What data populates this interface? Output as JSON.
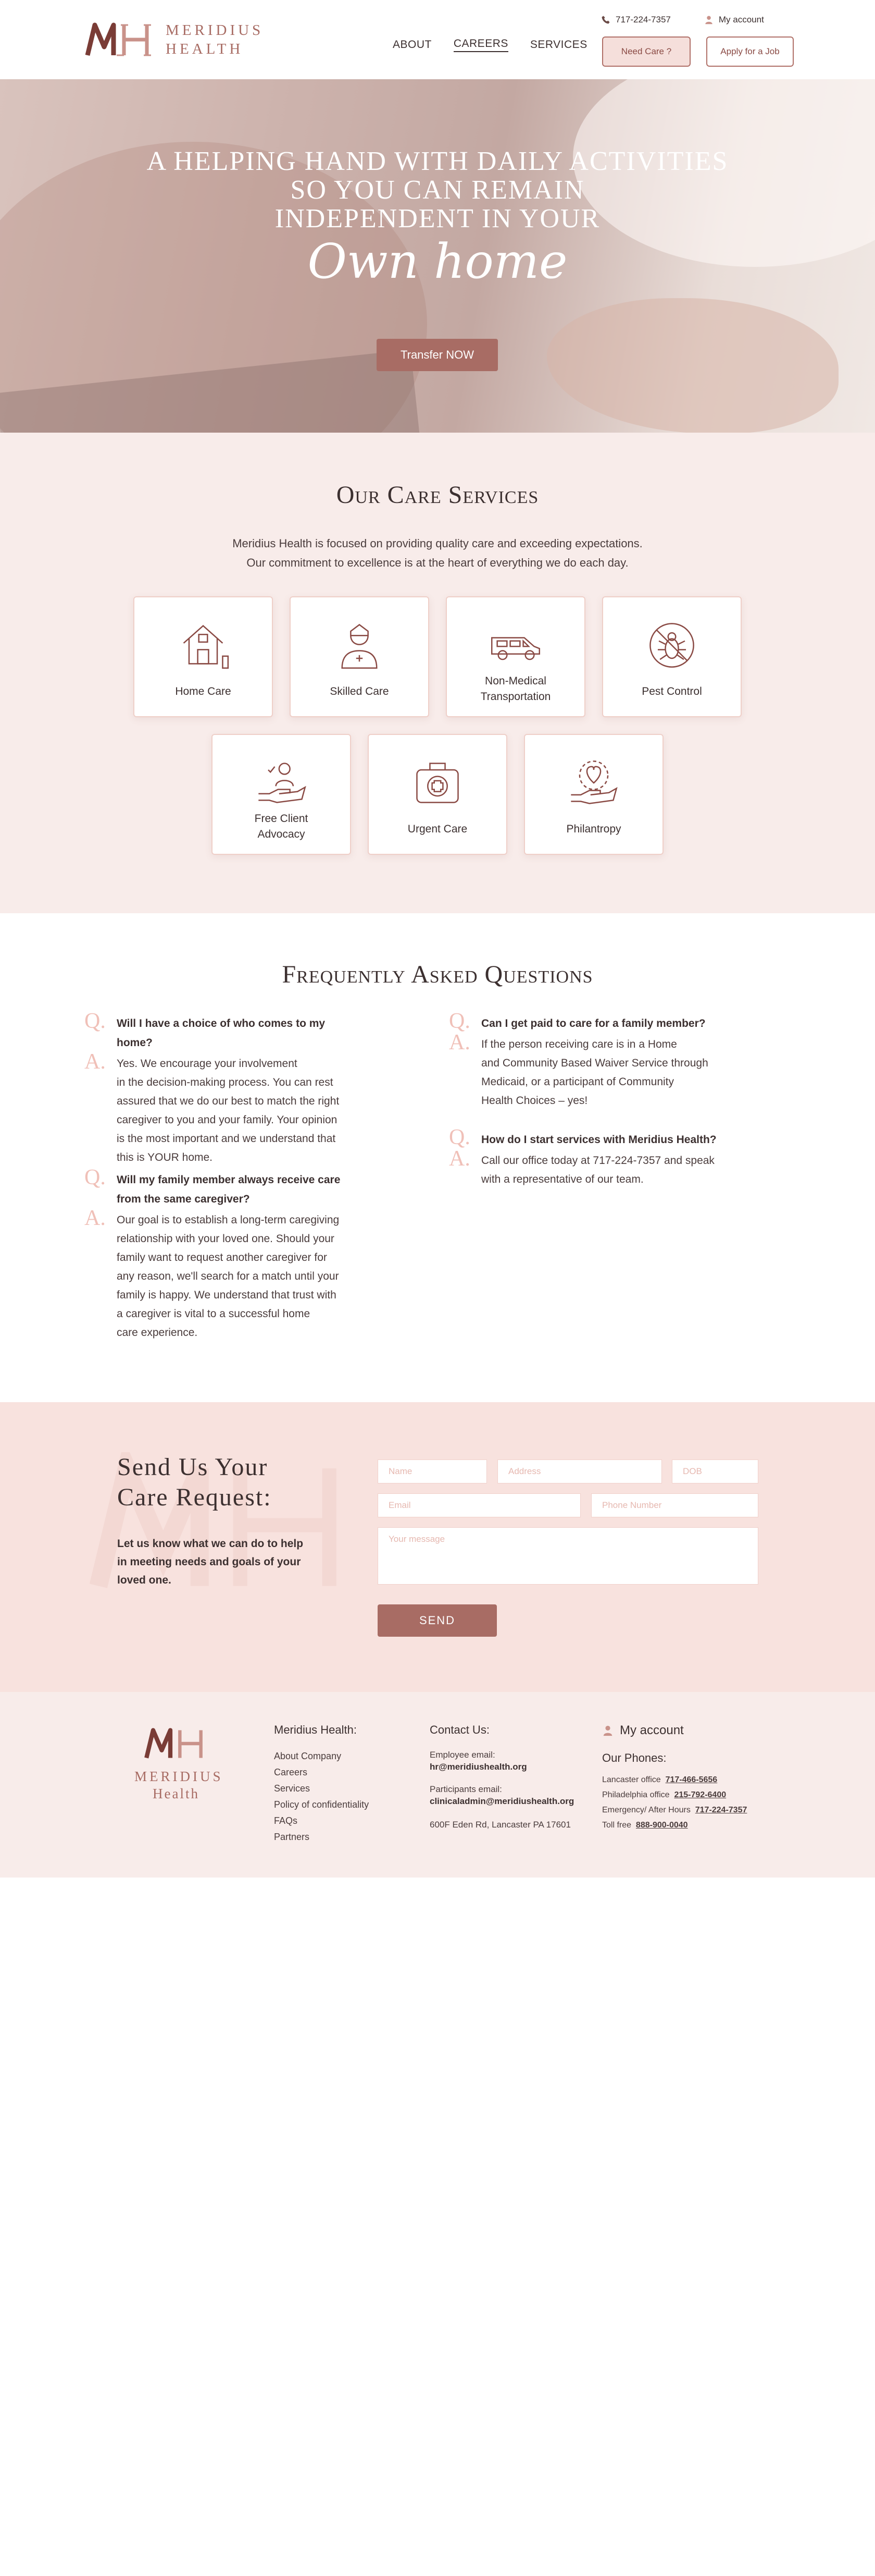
{
  "header": {
    "logo_line1": "MERIDIUS",
    "logo_line2": "HEALTH",
    "phone": "717-224-7357",
    "account": "My account",
    "nav": [
      {
        "label": "ABOUT"
      },
      {
        "label": "CAREERS"
      },
      {
        "label": "SERVICES"
      }
    ],
    "need_care": "Need Care ?",
    "apply": "Apply for a Job"
  },
  "hero": {
    "title_line1": "A helping hand with daily activities",
    "title_line2": "so you can remain",
    "title_line3": "independent in your",
    "script": "Own home",
    "button": "Transfer NOW"
  },
  "services": {
    "title": "Our Care Services",
    "subtitle_line1": "Meridius Health is focused on providing quality care and exceeding expectations.",
    "subtitle_line2": "Our commitment to excellence is at the heart of everything we do each day.",
    "cards": [
      {
        "label": "Home Care",
        "icon": "house-icon"
      },
      {
        "label": "Skilled Care",
        "icon": "nurse-icon"
      },
      {
        "label_line1": "Non-Medical",
        "label_line2": "Transportation",
        "icon": "van-icon"
      },
      {
        "label": "Pest Control",
        "icon": "bug-icon"
      },
      {
        "label_line1": "Free Client",
        "label_line2": "Advocacy",
        "icon": "hand-care-icon"
      },
      {
        "label": "Urgent Care",
        "icon": "first-aid-kit-icon"
      },
      {
        "label": "Philantropy",
        "icon": "heart-hand-icon"
      }
    ]
  },
  "faq": {
    "title": "Frequently Asked Questions",
    "q_letter": "Q.",
    "a_letter": "A.",
    "items": [
      {
        "q": "Will I have a choice of who comes to my home?",
        "a": [
          "Yes. We encourage your involvement",
          "in the decision-making process. You can rest",
          "assured that we do our best to match the right",
          "caregiver to you and your family. Your opinion",
          "is the most important and we understand that",
          "this is YOUR home."
        ]
      },
      {
        "q": [
          "Will my family member always receive care",
          "from the same caregiver?"
        ],
        "a": [
          "Our goal is to establish a long-term caregiving",
          "relationship with your loved one. Should your",
          "family want to request another caregiver for",
          "any reason, we'll search for a match until your",
          "family is happy. We understand that trust with",
          "a caregiver is vital to a successful home",
          "care experience."
        ]
      },
      {
        "q": "Can I get paid to care for a family member?",
        "a": [
          "If the person receiving care is in a Home",
          "and Community Based Waiver Service through",
          "Medicaid, or a participant of Community",
          "Health Choices – yes!"
        ]
      },
      {
        "q": "How do I start services with Meridius Health?",
        "a": [
          "Call our office today at 717-224-7357 and speak",
          "with a representative of our team."
        ]
      }
    ]
  },
  "request": {
    "title_line1": "Send Us Your",
    "title_line2": "Care Request:",
    "text_line1": "Let us know what we can do to help",
    "text_line2": "in meeting needs and goals of your",
    "text_line3": "loved one.",
    "placeholders": {
      "name": "Name",
      "address": "Address",
      "dob": "DOB",
      "email": "Email",
      "phone": "Phone Number",
      "message": "Your message"
    },
    "send": "SEND"
  },
  "footer": {
    "logo_line1": "MERIDIUS",
    "logo_line2": "Health",
    "col1_title": "Meridius Health:",
    "links": [
      "About Company",
      "Careers",
      "Services",
      "Policy of confidentiality",
      "FAQs",
      "Partners"
    ],
    "col2_title": "Contact Us:",
    "employee_label": "Employee email:",
    "employee_email": "hr@meridiushealth.org",
    "participants_label": "Participants email:",
    "participants_email": "clinicaladmin@meridiushealth.org",
    "address": "600F Eden Rd, Lancaster PA 17601",
    "account": "My account",
    "phones_title": "Our Phones:",
    "phones": [
      {
        "label": "Lancaster office",
        "number": "717-466-5656"
      },
      {
        "label": "Philadelphia office",
        "number": "215-792-6400"
      },
      {
        "label": "Emergency/ After Hours",
        "number": "717-224-7357"
      },
      {
        "label": "Toll free",
        "number": "888-900-0040"
      }
    ]
  },
  "colors": {
    "accent": "#a86c64",
    "accent_light": "#f8ecea",
    "request_bg": "#f8e2de",
    "text": "#3c3030"
  }
}
